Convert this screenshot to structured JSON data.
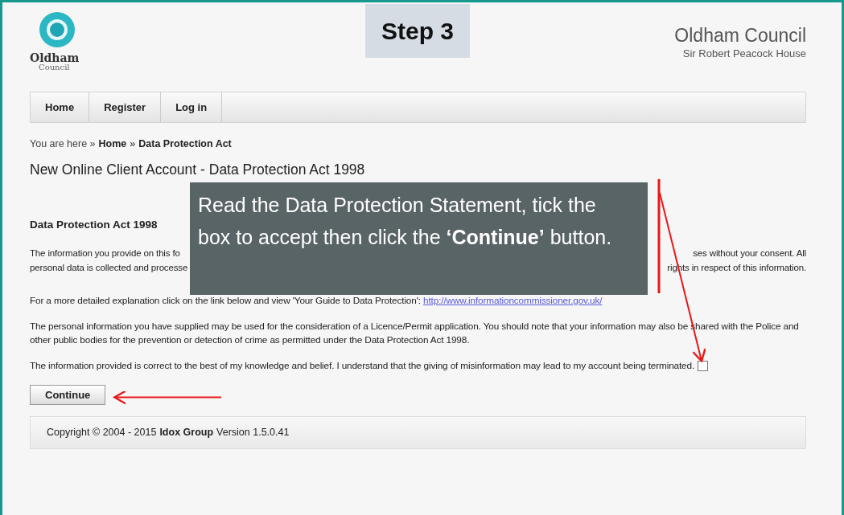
{
  "step_label": "Step 3",
  "logo": {
    "name": "Oldham",
    "sub": "Council"
  },
  "org": {
    "title": "Oldham Council",
    "subtitle": "Sir Robert Peacock House"
  },
  "nav": [
    {
      "label": "Home"
    },
    {
      "label": "Register"
    },
    {
      "label": "Log in"
    }
  ],
  "breadcrumb": {
    "prefix": "You are here »",
    "items": [
      "Home",
      "»",
      "Data Protection Act"
    ]
  },
  "page_title": "New Online Client Account - Data Protection Act 1998",
  "section_title": "Data Protection Act 1998",
  "paragraphs": [
    {
      "lines": [
        {
          "left": "The information you provide on this fo",
          "right": "ses without your consent. All"
        },
        {
          "left": "personal data is collected and processe",
          "right": "rights in respect of this information."
        }
      ]
    },
    {
      "text": "For a more detailed explanation click on the link below and view 'Your Guide to Data Protection':",
      "link": "http://www.informationcommissioner.gov.uk/"
    },
    {
      "text": "The personal information you have supplied may be used for the consideration of a Licence/Permit application. You should note that your information may also be shared with the Police and other public bodies for the prevention or detection of crime as permitted under the Data Protection Act 1998."
    }
  ],
  "declaration": {
    "text": "The information provided is correct to the best of my knowledge and belief. I understand that the giving of misinformation may lead to my account being terminated.",
    "checked": false
  },
  "continue_button": "Continue",
  "footer": {
    "prefix": "Copyright © 2004 - 2015",
    "company": "Idox Group",
    "version": "Version 1.5.0.41"
  },
  "callout": "Read the Data Protection Statement, tick the box to accept then click the **‘Continue’** button."
}
